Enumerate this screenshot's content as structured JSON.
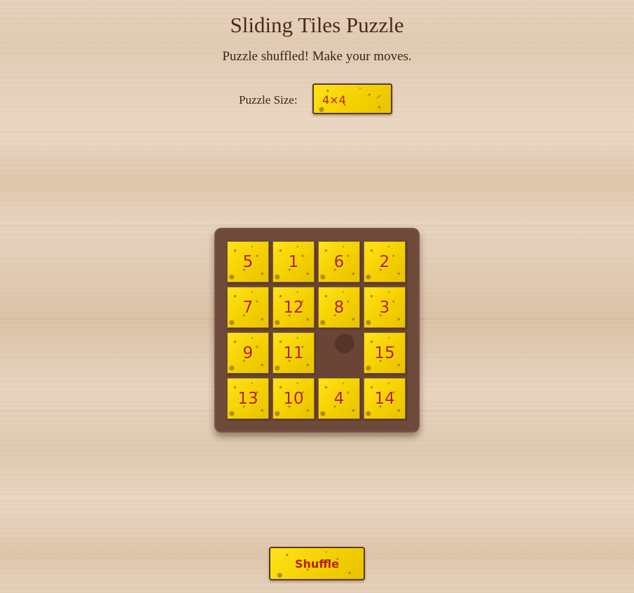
{
  "title": "Sliding Tiles Puzzle",
  "status": "Puzzle shuffled! Make your moves.",
  "size_control": {
    "label": "Puzzle Size:",
    "selected": "4×4",
    "chevron_icon": "chevron-down-icon"
  },
  "board": {
    "rows": 4,
    "cols": 4,
    "tiles": [
      [
        "5",
        "1",
        "6",
        "2"
      ],
      [
        "7",
        "12",
        "8",
        "3"
      ],
      [
        "9",
        "11",
        "",
        "15"
      ],
      [
        "13",
        "10",
        "4",
        "14"
      ]
    ]
  },
  "shuffle_label": "Shuffle",
  "colors": {
    "tile": "#f5d400",
    "tile_text": "#b51f14",
    "board": "#6e4a3b",
    "text": "#3d2314"
  }
}
